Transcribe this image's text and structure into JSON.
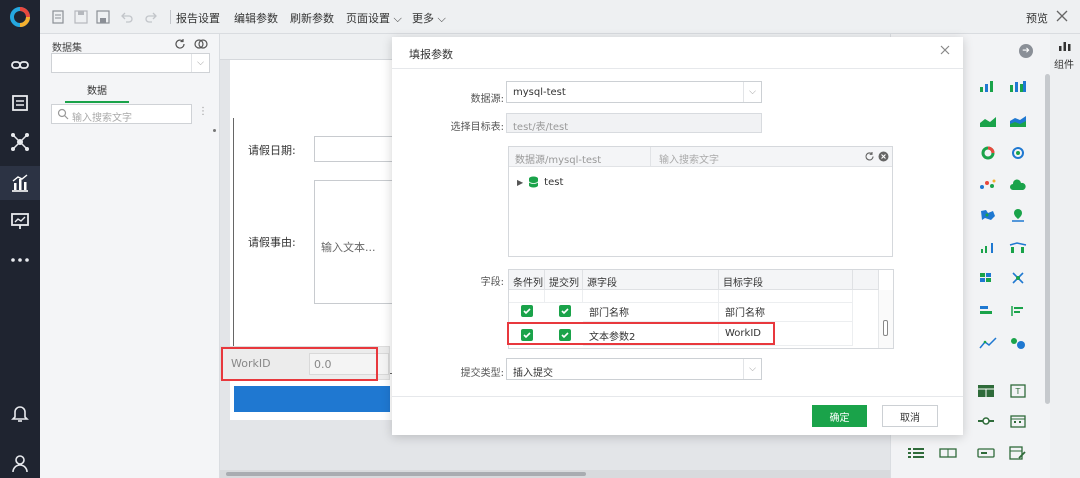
{
  "toolbar": {
    "menus": [
      "报告设置",
      "编辑参数",
      "刷新参数",
      "页面设置",
      "更多"
    ],
    "preview": "预览"
  },
  "data_panel": {
    "dataset_label": "数据集",
    "tab": "数据",
    "search_placeholder": "输入搜索文字"
  },
  "report": {
    "date_label": "请假日期:",
    "reason_label": "请假事由:",
    "reason_placeholder": "输入文本...",
    "workid_label": "WorkID",
    "workid_value": "0.0"
  },
  "right": {
    "component_label": "组件"
  },
  "modal": {
    "title": "填报参数",
    "datasource_label": "数据源:",
    "datasource_value": "mysql-test",
    "target_label": "选择目标表:",
    "target_value": "test/表/test",
    "tree_source": "数据源/mysql-test",
    "tree_search_placeholder": "输入搜索文字",
    "tree_node": "test",
    "fields_label": "字段:",
    "columns": [
      "条件列",
      "提交列",
      "源字段",
      "目标字段"
    ],
    "rows": [
      {
        "source": "部门名称",
        "target": "部门名称"
      },
      {
        "source": "文本参数2",
        "target": "WorkID"
      }
    ],
    "submit_type_label": "提交类型:",
    "submit_type_value": "插入提交",
    "ok": "确定",
    "cancel": "取消"
  },
  "colors": {
    "accent_green": "#1aa34a",
    "highlight_red": "#e8383d",
    "nav_dark": "#1f2430",
    "blue_bar": "#1f78d1"
  }
}
